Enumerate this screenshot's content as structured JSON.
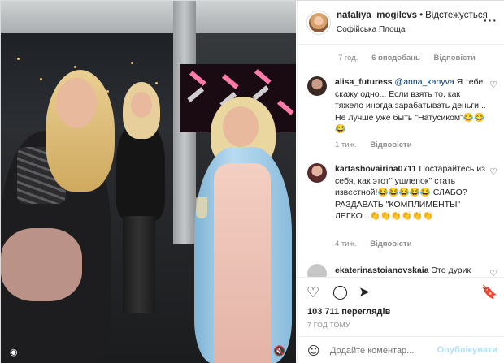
{
  "post": {
    "username": "nataliya_mogilevs",
    "separator": "•",
    "follow_label": "Відстежується",
    "location": "Софійська Площа",
    "more_icon": "more-horizontal-icon"
  },
  "caption_meta": {
    "time": "7 год.",
    "likes": "6 вподобань",
    "reply": "Відповісти"
  },
  "comments": [
    {
      "username": "alisa_futuress",
      "mention": "@anna_kanyva",
      "text": " Я тебе скажу одно... Если взять то, как тяжело иногда зарабатывать деньги... Не лучше уже быть \"Натусиком\"😂😂😂",
      "time": "1 тиж.",
      "reply": "Відповісти"
    },
    {
      "username": "kartashovairina0711",
      "text": " Постарайтесь из себя, как этот'' ушлепок'' стать известной!😂😂😂😂😂 СЛАБО? РАЗДАВАТЬ \"КОМПЛИМЕНТЫ\" ЛЕГКО...👏👏👏👏👏👏",
      "time": "4 тиж.",
      "reply": "Відповісти"
    },
    {
      "username": "ekaterinastoianovskaia",
      "text": " Это дурик"
    }
  ],
  "footer": {
    "views": "103 711 переглядів",
    "time_ago": "7 ГОД ТОМУ",
    "comment_placeholder": "Додайте коментар...",
    "publish_label": "Опублікувати"
  },
  "colors": {
    "link": "#00376b",
    "publish_disabled": "#b2dffc",
    "muted": "#8e8e8e"
  }
}
